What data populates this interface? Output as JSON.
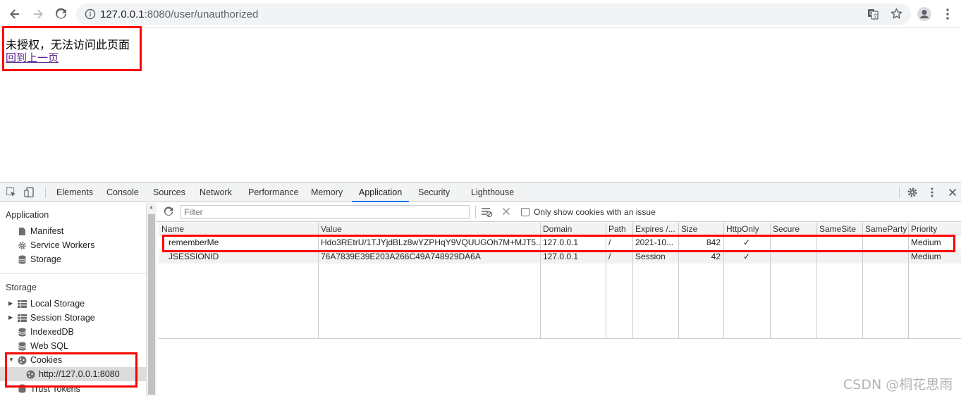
{
  "browser": {
    "url_host": "127.0.0.1",
    "url_rest": ":8080/user/unauthorized"
  },
  "page": {
    "message": "未授权，无法访问此页面",
    "back_link": "回到上一页"
  },
  "devtools": {
    "tabs": [
      {
        "label": "Elements"
      },
      {
        "label": "Console"
      },
      {
        "label": "Sources"
      },
      {
        "label": "Network"
      },
      {
        "label": "Performance"
      },
      {
        "label": "Memory"
      },
      {
        "label": "Application"
      },
      {
        "label": "Security"
      },
      {
        "label": "Lighthouse"
      }
    ],
    "active_tab": "Application",
    "sidebar": {
      "application_header": "Application",
      "application_items": [
        "Manifest",
        "Service Workers",
        "Storage"
      ],
      "storage_header": "Storage",
      "storage_items": [
        "Local Storage",
        "Session Storage",
        "IndexedDB",
        "Web SQL",
        "Cookies"
      ],
      "cookies_origin": "http://127.0.0.1:8080",
      "trust_tokens": "Trust Tokens"
    },
    "cookies": {
      "filter_placeholder": "Filter",
      "only_issues_label": "Only show cookies with an issue",
      "columns": [
        "Name",
        "Value",
        "Domain",
        "Path",
        "Expires /...",
        "Size",
        "HttpOnly",
        "Secure",
        "SameSite",
        "SameParty",
        "Priority"
      ],
      "rows": [
        {
          "name": "rememberMe",
          "value": "Hdo3REtrU/1TJYjdBLz8wYZPHqY9VQUUGOh7M+MJT5...",
          "domain": "127.0.0.1",
          "path": "/",
          "expires": "2021-10...",
          "size": "842",
          "httponly": "✓",
          "secure": "",
          "samesite": "",
          "sameparty": "",
          "priority": "Medium"
        },
        {
          "name": "JSESSIONID",
          "value": "76A7839E39E203A266C49A748929DA6A",
          "domain": "127.0.0.1",
          "path": "/",
          "expires": "Session",
          "size": "42",
          "httponly": "✓",
          "secure": "",
          "samesite": "",
          "sameparty": "",
          "priority": "Medium"
        }
      ]
    }
  },
  "watermark": "CSDN @桐花思雨",
  "colors": {
    "highlight": "#ff0000",
    "active_tab_underline": "#1a73e8",
    "link_visited": "#551a8b"
  }
}
